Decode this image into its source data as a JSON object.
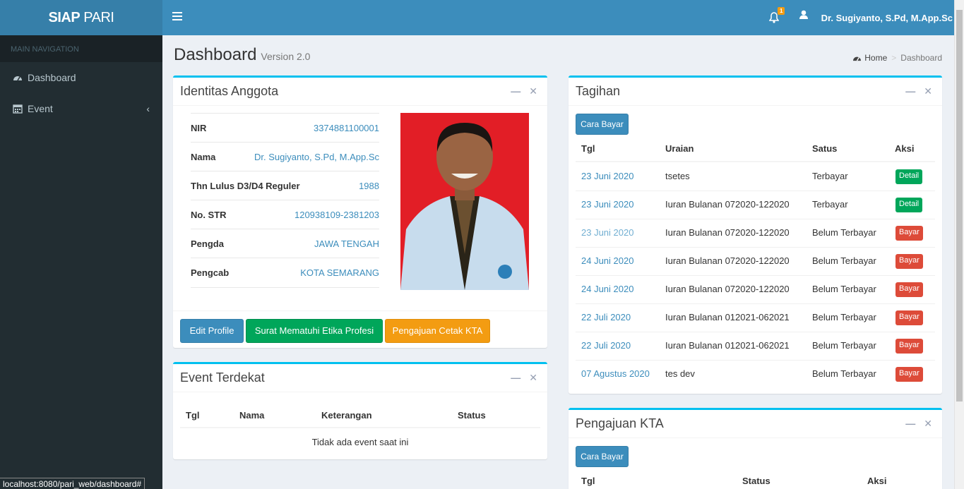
{
  "header": {
    "logo_bold": "SIAP",
    "logo_light": " PARI",
    "notif_count": "1",
    "user_name": "Dr. Sugiyanto, S.Pd, M.App.Sc"
  },
  "sidebar": {
    "heading": "MAIN NAVIGATION",
    "items": [
      {
        "label": "Dashboard",
        "icon": "dashboard-icon"
      },
      {
        "label": "Event",
        "icon": "calendar-icon"
      }
    ]
  },
  "page": {
    "title": "Dashboard",
    "subtitle": "Version 2.0",
    "breadcrumb": {
      "home": "Home",
      "current": "Dashboard"
    }
  },
  "identitas": {
    "title": "Identitas Anggota",
    "rows": [
      {
        "label": "NIR",
        "value": "3374881100001"
      },
      {
        "label": "Nama",
        "value": "Dr. Sugiyanto, S.Pd, M.App.Sc"
      },
      {
        "label": "Thn Lulus D3/D4 Reguler",
        "value": "1988"
      },
      {
        "label": "No. STR",
        "value": "120938109-2381203"
      },
      {
        "label": "Pengda",
        "value": "JAWA TENGAH"
      },
      {
        "label": "Pengcab",
        "value": "KOTA SEMARANG"
      }
    ],
    "buttons": {
      "edit": "Edit Profile",
      "surat": "Surat Mematuhi Etika Profesi",
      "cetak": "Pengajuan Cetak KTA"
    }
  },
  "event": {
    "title": "Event Terdekat",
    "columns": [
      "Tgl",
      "Nama",
      "Keterangan",
      "Status"
    ],
    "empty": "Tidak ada event saat ini"
  },
  "tagihan": {
    "title": "Tagihan",
    "cara_bayar": "Cara Bayar",
    "columns": [
      "Tgl",
      "Uraian",
      "Satus",
      "Aksi"
    ],
    "rows": [
      {
        "tgl": "23 Juni 2020",
        "uraian": "tsetes",
        "status": "Terbayar",
        "aksi": "Detail"
      },
      {
        "tgl": "23 Juni 2020",
        "uraian": "Iuran Bulanan 072020-122020",
        "status": "Terbayar",
        "aksi": "Detail"
      },
      {
        "tgl": "23 Juni 2020",
        "uraian": "Iuran Bulanan 072020-122020",
        "status": "Belum Terbayar",
        "aksi": "Bayar"
      },
      {
        "tgl": "24 Juni 2020",
        "uraian": "Iuran Bulanan 072020-122020",
        "status": "Belum Terbayar",
        "aksi": "Bayar"
      },
      {
        "tgl": "24 Juni 2020",
        "uraian": "Iuran Bulanan 072020-122020",
        "status": "Belum Terbayar",
        "aksi": "Bayar"
      },
      {
        "tgl": "22 Juli 2020",
        "uraian": "Iuran Bulanan 012021-062021",
        "status": "Belum Terbayar",
        "aksi": "Bayar"
      },
      {
        "tgl": "22 Juli 2020",
        "uraian": "Iuran Bulanan 012021-062021",
        "status": "Belum Terbayar",
        "aksi": "Bayar"
      },
      {
        "tgl": "07 Agustus 2020",
        "uraian": "tes dev",
        "status": "Belum Terbayar",
        "aksi": "Bayar"
      }
    ]
  },
  "kta": {
    "title": "Pengajuan KTA",
    "cara_bayar": "Cara Bayar",
    "columns": [
      "Tgl",
      "Status",
      "Aksi"
    ]
  },
  "status_url": "localhost:8080/pari_web/dashboard#"
}
